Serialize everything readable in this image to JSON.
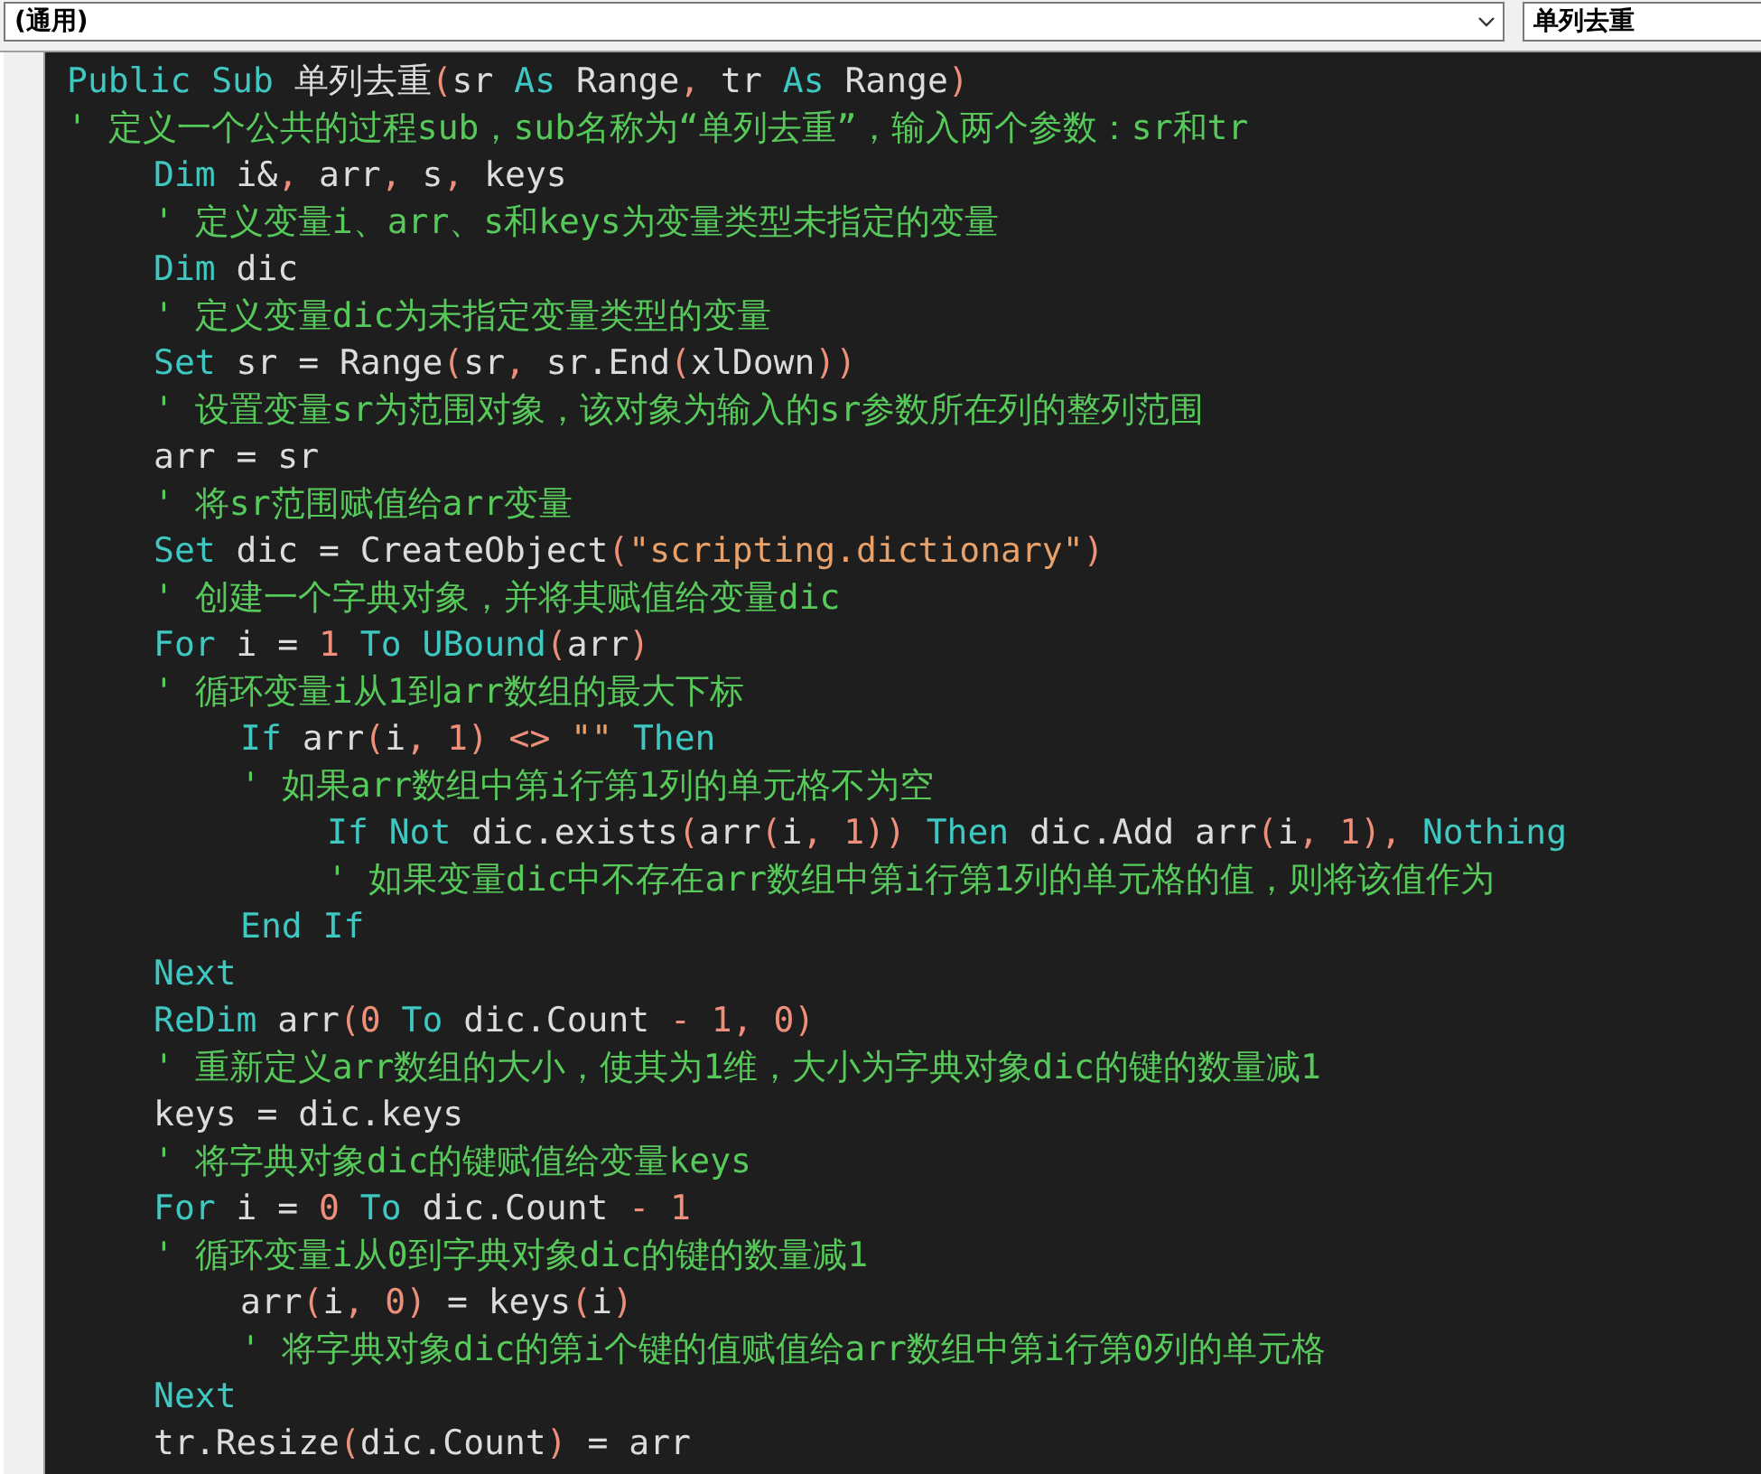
{
  "object_dropdown": {
    "value": "(通用)"
  },
  "procedure_dropdown": {
    "value": "单列去重"
  },
  "lines": [
    {
      "kind": "code",
      "tokens": [
        {
          "kind": "keyword",
          "text": "Public Sub"
        },
        {
          "kind": "plain",
          "text": " 单列去重"
        },
        {
          "kind": "symbol",
          "text": "("
        },
        {
          "kind": "plain",
          "text": "sr "
        },
        {
          "kind": "keyword",
          "text": "As"
        },
        {
          "kind": "plain",
          "text": " Range"
        },
        {
          "kind": "symbol",
          "text": ","
        },
        {
          "kind": "plain",
          "text": " tr "
        },
        {
          "kind": "keyword",
          "text": "As"
        },
        {
          "kind": "plain",
          "text": " Range"
        },
        {
          "kind": "symbol",
          "text": ")"
        }
      ]
    },
    {
      "kind": "comment",
      "text": "' 定义一个公共的过程sub，sub名称为“单列去重”，输入两个参数：sr和tr",
      "children": [
        {
          "kind": "code",
          "tokens": [
            {
              "kind": "keyword",
              "text": "Dim"
            },
            {
              "kind": "plain",
              "text": " i&"
            },
            {
              "kind": "symbol",
              "text": ","
            },
            {
              "kind": "plain",
              "text": " arr"
            },
            {
              "kind": "symbol",
              "text": ","
            },
            {
              "kind": "plain",
              "text": " s"
            },
            {
              "kind": "symbol",
              "text": ","
            },
            {
              "kind": "plain",
              "text": " keys"
            }
          ]
        },
        {
          "kind": "comment",
          "text": "' 定义变量i、arr、s和keys为变量类型未指定的变量"
        },
        {
          "kind": "code",
          "tokens": [
            {
              "kind": "keyword",
              "text": "Dim"
            },
            {
              "kind": "plain",
              "text": " dic"
            }
          ]
        },
        {
          "kind": "comment",
          "text": "' 定义变量dic为未指定变量类型的变量"
        },
        {
          "kind": "code",
          "tokens": [
            {
              "kind": "keyword",
              "text": "Set"
            },
            {
              "kind": "plain",
              "text": " sr = Range"
            },
            {
              "kind": "symbol",
              "text": "("
            },
            {
              "kind": "plain",
              "text": "sr"
            },
            {
              "kind": "symbol",
              "text": ","
            },
            {
              "kind": "plain",
              "text": " sr.End"
            },
            {
              "kind": "symbol",
              "text": "("
            },
            {
              "kind": "plain",
              "text": "xlDown"
            },
            {
              "kind": "symbol",
              "text": "))"
            }
          ]
        },
        {
          "kind": "comment",
          "text": "' 设置变量sr为范围对象，该对象为输入的sr参数所在列的整列范围"
        },
        {
          "kind": "code",
          "tokens": [
            {
              "kind": "plain",
              "text": "arr = sr"
            }
          ]
        },
        {
          "kind": "comment",
          "text": "' 将sr范围赋值给arr变量"
        },
        {
          "kind": "code",
          "tokens": [
            {
              "kind": "keyword",
              "text": "Set"
            },
            {
              "kind": "plain",
              "text": " dic = CreateObject"
            },
            {
              "kind": "symbol",
              "text": "("
            },
            {
              "kind": "string",
              "text": "\"scripting.dictionary\""
            },
            {
              "kind": "symbol",
              "text": ")"
            }
          ]
        },
        {
          "kind": "comment",
          "text": "' 创建一个字典对象，并将其赋值给变量dic"
        },
        {
          "kind": "code",
          "tokens": [
            {
              "kind": "keyword",
              "text": "For"
            },
            {
              "kind": "plain",
              "text": " i ="
            },
            {
              "kind": "symbol",
              "text": " 1"
            },
            {
              "kind": "keyword",
              "text": " To"
            },
            {
              "kind": "keyword",
              "text": " UBound"
            },
            {
              "kind": "symbol",
              "text": "("
            },
            {
              "kind": "plain",
              "text": "arr"
            },
            {
              "kind": "symbol",
              "text": ")"
            }
          ]
        },
        {
          "kind": "comment",
          "text": "' 循环变量i从1到arr数组的最大下标",
          "children": [
            {
              "kind": "code",
              "tokens": [
                {
                  "kind": "keyword",
                  "text": "If"
                },
                {
                  "kind": "plain",
                  "text": " arr"
                },
                {
                  "kind": "symbol",
                  "text": "("
                },
                {
                  "kind": "plain",
                  "text": "i"
                },
                {
                  "kind": "symbol",
                  "text": ","
                },
                {
                  "kind": "symbol",
                  "text": " 1)"
                },
                {
                  "kind": "symbol",
                  "text": " <>"
                },
                {
                  "kind": "string",
                  "text": " \"\""
                },
                {
                  "kind": "keyword",
                  "text": " Then"
                }
              ]
            },
            {
              "kind": "comment",
              "text": "' 如果arr数组中第i行第1列的单元格不为空",
              "children": [
                {
                  "kind": "code",
                  "tokens": [
                    {
                      "kind": "keyword",
                      "text": "If Not"
                    },
                    {
                      "kind": "plain",
                      "text": " dic.exists"
                    },
                    {
                      "kind": "symbol",
                      "text": "("
                    },
                    {
                      "kind": "plain",
                      "text": "arr"
                    },
                    {
                      "kind": "symbol",
                      "text": "("
                    },
                    {
                      "kind": "plain",
                      "text": "i"
                    },
                    {
                      "kind": "symbol",
                      "text": ","
                    },
                    {
                      "kind": "symbol",
                      "text": " 1))"
                    },
                    {
                      "kind": "keyword",
                      "text": " Then"
                    },
                    {
                      "kind": "plain",
                      "text": " dic.Add arr"
                    },
                    {
                      "kind": "symbol",
                      "text": "("
                    },
                    {
                      "kind": "plain",
                      "text": "i"
                    },
                    {
                      "kind": "symbol",
                      "text": ","
                    },
                    {
                      "kind": "symbol",
                      "text": " 1),"
                    },
                    {
                      "kind": "keyword",
                      "text": " Nothing"
                    }
                  ]
                },
                {
                  "kind": "comment",
                  "text": "' 如果变量dic中不存在arr数组中第i行第1列的单元格的值，则将该值作为"
                }
              ]
            },
            {
              "kind": "code",
              "tokens": [
                {
                  "kind": "keyword",
                  "text": "End If"
                }
              ]
            }
          ]
        },
        {
          "kind": "code",
          "tokens": [
            {
              "kind": "keyword",
              "text": "Next"
            }
          ]
        },
        {
          "kind": "code",
          "tokens": [
            {
              "kind": "keyword",
              "text": "ReDim"
            },
            {
              "kind": "plain",
              "text": " arr"
            },
            {
              "kind": "symbol",
              "text": "(0"
            },
            {
              "kind": "keyword",
              "text": " To"
            },
            {
              "kind": "plain",
              "text": " dic.Count"
            },
            {
              "kind": "symbol",
              "text": " - 1,"
            },
            {
              "kind": "symbol",
              "text": " 0)"
            }
          ]
        },
        {
          "kind": "comment",
          "text": "' 重新定义arr数组的大小，使其为1维，大小为字典对象dic的键的数量减1"
        },
        {
          "kind": "code",
          "tokens": [
            {
              "kind": "plain",
              "text": "keys = dic.keys"
            }
          ]
        },
        {
          "kind": "comment",
          "text": "' 将字典对象dic的键赋值给变量keys"
        },
        {
          "kind": "code",
          "tokens": [
            {
              "kind": "keyword",
              "text": "For"
            },
            {
              "kind": "plain",
              "text": " i ="
            },
            {
              "kind": "symbol",
              "text": " 0"
            },
            {
              "kind": "keyword",
              "text": " To"
            },
            {
              "kind": "plain",
              "text": " dic.Count"
            },
            {
              "kind": "symbol",
              "text": " - 1"
            }
          ]
        },
        {
          "kind": "comment",
          "text": "' 循环变量i从0到字典对象dic的键的数量减1",
          "children": [
            {
              "kind": "code",
              "tokens": [
                {
                  "kind": "plain",
                  "text": "arr"
                },
                {
                  "kind": "symbol",
                  "text": "("
                },
                {
                  "kind": "plain",
                  "text": "i"
                },
                {
                  "kind": "symbol",
                  "text": ","
                },
                {
                  "kind": "symbol",
                  "text": " 0)"
                },
                {
                  "kind": "plain",
                  "text": " = keys"
                },
                {
                  "kind": "symbol",
                  "text": "("
                },
                {
                  "kind": "plain",
                  "text": "i"
                },
                {
                  "kind": "symbol",
                  "text": ")"
                }
              ]
            },
            {
              "kind": "comment",
              "text": "' 将字典对象dic的第i个键的值赋值给arr数组中第i行第0列的单元格"
            }
          ]
        },
        {
          "kind": "code",
          "tokens": [
            {
              "kind": "keyword",
              "text": "Next"
            }
          ]
        },
        {
          "kind": "code",
          "tokens": [
            {
              "kind": "plain",
              "text": "tr.Resize"
            },
            {
              "kind": "symbol",
              "text": "("
            },
            {
              "kind": "plain",
              "text": "dic.Count"
            },
            {
              "kind": "symbol",
              "text": ")"
            },
            {
              "kind": "plain",
              "text": " = arr"
            }
          ]
        }
      ]
    }
  ]
}
